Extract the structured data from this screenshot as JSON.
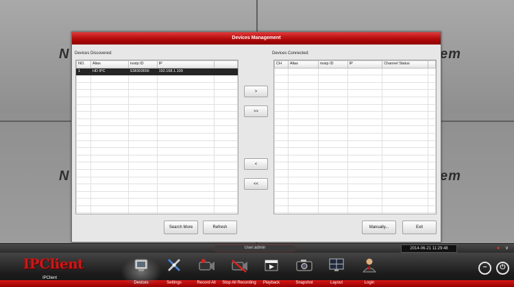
{
  "dialog": {
    "title": "Devices Management",
    "discovered_label": "Devices Discovered:",
    "connected_label": "Devices Connected:",
    "discovered_headers": [
      "NO.",
      "Alias",
      "nvsip ID",
      "IP"
    ],
    "discovered_rows": [
      [
        "1",
        "HD IPC",
        "S38303656",
        "192.168.1.109"
      ]
    ],
    "connected_headers": [
      "CH",
      "Alias",
      "nvsip ID",
      "IP",
      "Channel Status"
    ],
    "move_buttons": [
      ">",
      ">>",
      "<",
      "<<"
    ],
    "search_more": "Search More",
    "refresh": "Refresh",
    "manually": "Manually...",
    "exit": "Exit"
  },
  "status": {
    "user": "User:admin",
    "datetime": "2014-06-21 11:29:48"
  },
  "toolbar": {
    "logo": "IPClient",
    "client_label": "IPClient",
    "items": [
      {
        "label": "Devices",
        "icon": "devices-icon"
      },
      {
        "label": "Settings",
        "icon": "settings-icon"
      },
      {
        "label": "Record All",
        "icon": "record-all-icon"
      },
      {
        "label": "Stop All Recording",
        "icon": "stop-recording-icon"
      },
      {
        "label": "Playback",
        "icon": "playback-icon"
      },
      {
        "label": "Snapshot",
        "icon": "snapshot-icon"
      },
      {
        "label": "Layout",
        "icon": "layout-icon"
      },
      {
        "label": "Login",
        "icon": "login-icon"
      }
    ]
  },
  "colors": {
    "accent": "#c00000",
    "selected_row": "#262626"
  }
}
